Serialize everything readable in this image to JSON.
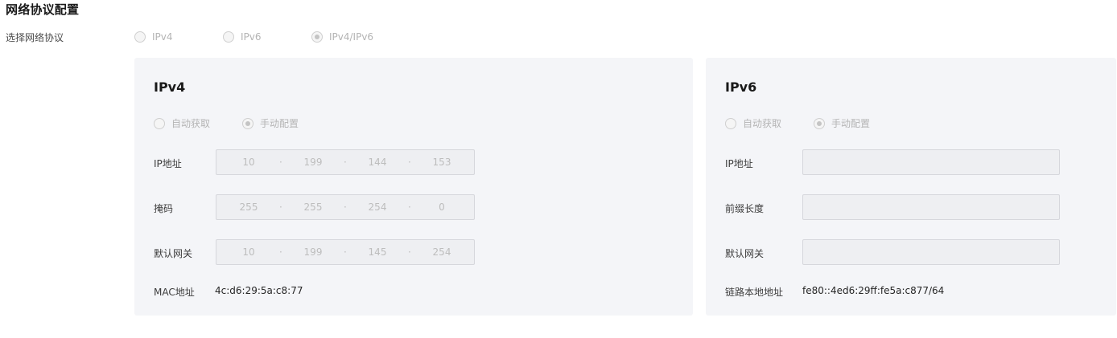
{
  "section": {
    "title": "网络协议配置"
  },
  "protocol": {
    "label": "选择网络协议",
    "options": [
      {
        "label": "IPv4",
        "checked": false
      },
      {
        "label": "IPv6",
        "checked": false
      },
      {
        "label": "IPv4/IPv6",
        "checked": true
      }
    ]
  },
  "ipv4": {
    "title": "IPv4",
    "mode_options": [
      {
        "label": "自动获取",
        "checked": false
      },
      {
        "label": "手动配置",
        "checked": true
      }
    ],
    "ip_label": "IP地址",
    "ip": [
      "10",
      "199",
      "144",
      "153"
    ],
    "mask_label": "掩码",
    "mask": [
      "255",
      "255",
      "254",
      "0"
    ],
    "gateway_label": "默认网关",
    "gateway": [
      "10",
      "199",
      "145",
      "254"
    ],
    "mac_label": "MAC地址",
    "mac": "4c:d6:29:5a:c8:77"
  },
  "ipv6": {
    "title": "IPv6",
    "mode_options": [
      {
        "label": "自动获取",
        "checked": false
      },
      {
        "label": "手动配置",
        "checked": true
      }
    ],
    "ip_label": "IP地址",
    "ip_value": "",
    "prefix_label": "前缀长度",
    "prefix_value": "",
    "gateway_label": "默认网关",
    "gateway_value": "",
    "link_local_label": "链路本地地址",
    "link_local": "fe80::4ed6:29ff:fe5a:c877/64"
  }
}
